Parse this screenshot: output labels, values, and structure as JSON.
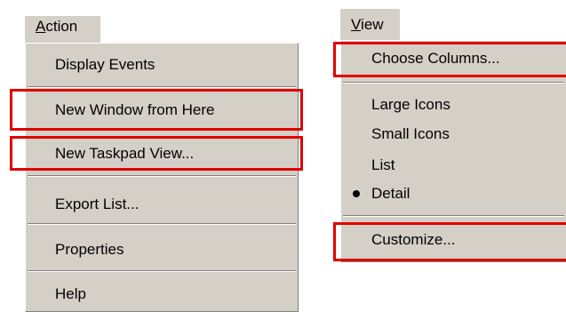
{
  "action_menu": {
    "title_accel": "A",
    "title_rest": "ction",
    "items": [
      {
        "label": "Display Events",
        "highlighted": false
      },
      {
        "label": "New Window from Here",
        "highlighted": true
      },
      {
        "label": "New Taskpad View...",
        "highlighted": true
      },
      {
        "label": "Export List...",
        "highlighted": false
      },
      {
        "label": "Properties",
        "highlighted": false
      },
      {
        "label": "Help",
        "highlighted": false
      }
    ]
  },
  "view_menu": {
    "title_accel": "V",
    "title_rest": "iew",
    "items": [
      {
        "label": "Choose Columns...",
        "highlighted": true
      },
      {
        "label": "Large Icons",
        "highlighted": false
      },
      {
        "label": "Small Icons",
        "highlighted": false
      },
      {
        "label": "List",
        "highlighted": false
      },
      {
        "label": "Detail",
        "highlighted": false,
        "checked": true,
        "checked_icon": "radio-bullet-icon"
      },
      {
        "label": "Customize...",
        "highlighted": true
      }
    ]
  },
  "colors": {
    "menu_background": "#d4d0c8",
    "highlight_outline": "#e00000"
  }
}
